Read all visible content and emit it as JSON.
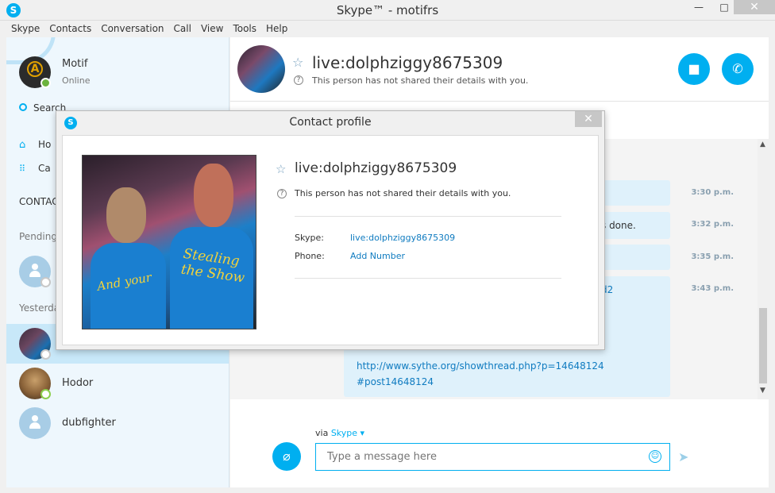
{
  "window": {
    "title": "Skype™ - motifrs",
    "minimize": "—",
    "maximize": "□",
    "close": "✕"
  },
  "menu": [
    "Skype",
    "Contacts",
    "Conversation",
    "Call",
    "View",
    "Tools",
    "Help"
  ],
  "profile": {
    "name": "Motif",
    "status": "Online"
  },
  "sidebar": {
    "search_label": "Search",
    "home_label": "Ho",
    "calls_label": "Ca",
    "contacts_header": "CONTAC",
    "pending_header": "Pending",
    "yesterday_header": "Yesterday",
    "contacts": [
      {
        "name": ""
      },
      {
        "name": ""
      },
      {
        "name": "Hodor"
      },
      {
        "name": "dubfighter"
      }
    ]
  },
  "conversation": {
    "contact_name": "live:dolphziggy8675309",
    "subtitle": "This person has not shared their details with you.",
    "messages": [
      {
        "time": "3:30 p.m.",
        "text": ""
      },
      {
        "time": "3:32 p.m.",
        "text": "s done."
      },
      {
        "time": "3:35 p.m.",
        "text": ""
      },
      {
        "time": "3:43 p.m.",
        "text": "d2",
        "link_line1": "http://www.sythe.org/showthread.php?p=14648124",
        "link_line2": "#post14648124"
      }
    ],
    "via_label": "via",
    "via_service": "Skype",
    "input_placeholder": "Type a message here"
  },
  "dialog": {
    "title": "Contact profile",
    "close": "✕",
    "name": "live:dolphziggy8675309",
    "subtitle": "This person has not shared their details with you.",
    "skype_label": "Skype:",
    "skype_value": "live:dolphziggy8675309",
    "phone_label": "Phone:",
    "phone_value": "Add Number",
    "photo_text1": "And your",
    "photo_text2": "Stealing the Show"
  },
  "colors": {
    "accent": "#00aff0",
    "link": "#0f7bc0",
    "bubble": "#dff1fb"
  }
}
